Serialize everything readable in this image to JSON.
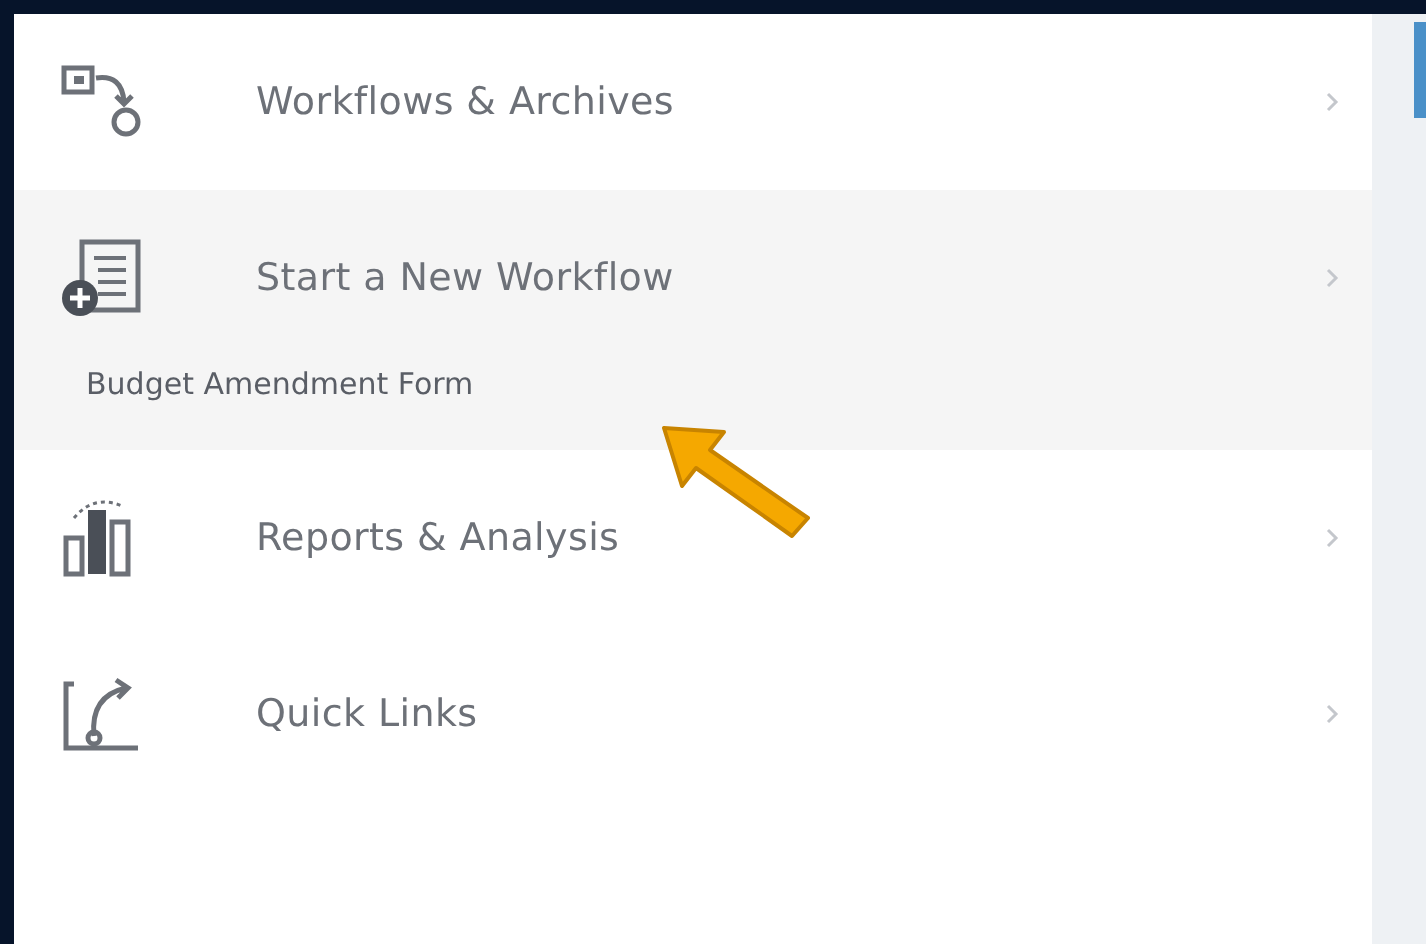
{
  "menu": {
    "items": [
      {
        "label": "Workflows & Archives",
        "expanded": false
      },
      {
        "label": "Start a New Workflow",
        "expanded": true,
        "children": [
          {
            "label": "Budget Amendment Form"
          }
        ]
      },
      {
        "label": "Reports & Analysis",
        "expanded": false
      },
      {
        "label": "Quick Links",
        "expanded": false
      }
    ]
  }
}
